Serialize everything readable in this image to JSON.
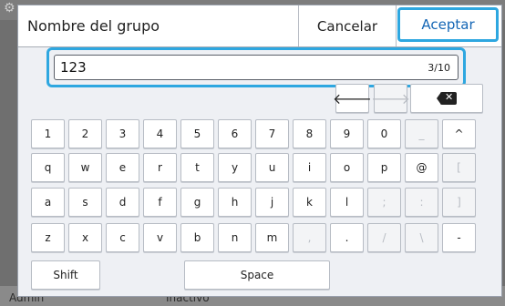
{
  "background": {
    "user_label": "Admin",
    "status_label": "Inactivo"
  },
  "dialog": {
    "title": "Nombre del grupo",
    "cancel_label": "Cancelar",
    "accept_label": "Aceptar",
    "input_value": "123",
    "char_count": "3/10"
  },
  "keyboard": {
    "rows": [
      [
        "1",
        "2",
        "3",
        "4",
        "5",
        "6",
        "7",
        "8",
        "9",
        "0",
        "_",
        "^"
      ],
      [
        "q",
        "w",
        "e",
        "r",
        "t",
        "y",
        "u",
        "i",
        "o",
        "p",
        "@",
        "["
      ],
      [
        "a",
        "s",
        "d",
        "f",
        "g",
        "h",
        "j",
        "k",
        "l",
        ";",
        ":",
        "]"
      ],
      [
        "z",
        "x",
        "c",
        "v",
        "b",
        "n",
        "m",
        ",",
        ".",
        "/",
        "\\",
        "-"
      ]
    ],
    "shift_label": "Shift",
    "space_label": "Space"
  },
  "colors": {
    "accent": "#2ea7e0",
    "accept_text": "#1466b5"
  },
  "icons": {
    "left_arrow": "left-arrow-icon",
    "right_arrow": "right-arrow-icon",
    "backspace": "backspace-icon"
  }
}
